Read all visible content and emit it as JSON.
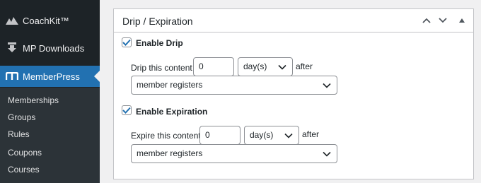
{
  "sidebar": {
    "items": [
      {
        "label": "CoachKit™",
        "icon": "mountain-icon"
      },
      {
        "label": "MP Downloads",
        "icon": "download-icon"
      },
      {
        "label": "MemberPress",
        "icon": "memberpress-logo-icon",
        "active": true
      }
    ],
    "submenu": [
      "Memberships",
      "Groups",
      "Rules",
      "Coupons",
      "Courses"
    ]
  },
  "panel": {
    "title": "Drip / Expiration",
    "drip": {
      "checkbox_label": "Enable Drip",
      "checked": true,
      "prefix": "Drip this content",
      "amount": "0",
      "unit": "day(s)",
      "suffix": "after",
      "event": "member registers"
    },
    "expiration": {
      "checkbox_label": "Enable Expiration",
      "checked": true,
      "prefix": "Expire this content",
      "amount": "0",
      "unit": "day(s)",
      "suffix": "after",
      "event": "member registers"
    }
  },
  "colors": {
    "sidebar_bg": "#1d2327",
    "submenu_bg": "#2c3338",
    "accent": "#2271b1",
    "page_bg": "#f0f0f1"
  }
}
